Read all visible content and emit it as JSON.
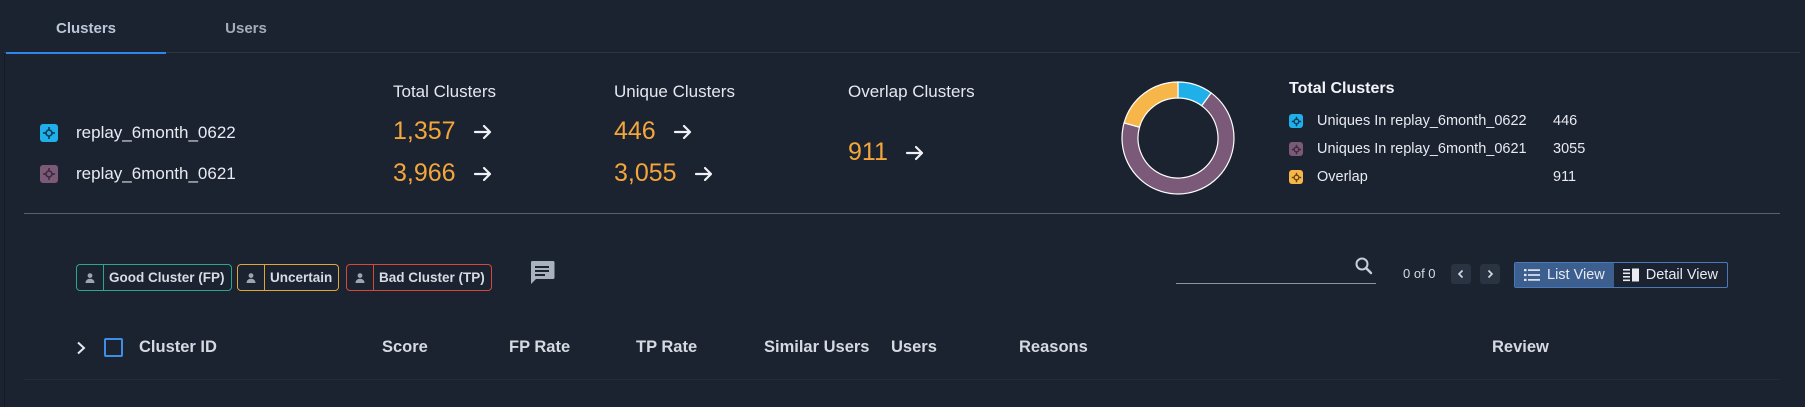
{
  "tabs": [
    {
      "label": "Clusters",
      "active": true
    },
    {
      "label": "Users",
      "active": false
    }
  ],
  "datasets": [
    {
      "name": "replay_6month_0622",
      "color": "#1fb0ea"
    },
    {
      "name": "replay_6month_0621",
      "color": "#7a5a78"
    }
  ],
  "metrics": {
    "total": {
      "title": "Total Clusters",
      "values": [
        "1,357",
        "3,966"
      ]
    },
    "unique": {
      "title": "Unique Clusters",
      "values": [
        "446",
        "3,055"
      ]
    },
    "overlap": {
      "title": "Overlap Clusters",
      "value": "911"
    }
  },
  "chart_data": {
    "type": "pie",
    "title": "Total Clusters",
    "categories": [
      "Uniques In replay_6month_0622",
      "Uniques In replay_6month_0621",
      "Overlap"
    ],
    "values": [
      446,
      3055,
      911
    ],
    "colors": [
      "#1fb0ea",
      "#7a5a78",
      "#f6b64a"
    ],
    "legend_placement": "right"
  },
  "legend": {
    "title": "Total Clusters",
    "rows": [
      {
        "label": "Uniques In replay_6month_0622",
        "value": "446",
        "color": "#1fb0ea"
      },
      {
        "label": "Uniques In replay_6month_0621",
        "value": "3055",
        "color": "#7a5a78"
      },
      {
        "label": "Overlap",
        "value": "911",
        "color": "#f6b64a"
      }
    ]
  },
  "feedback": {
    "good": {
      "label": "Good Cluster (FP)",
      "color": "#2fa58c"
    },
    "uncertain": {
      "label": "Uncertain",
      "color": "#e0a63a"
    },
    "bad": {
      "label": "Bad Cluster (TP)",
      "color": "#d6483a"
    }
  },
  "search": {
    "placeholder": "",
    "value": ""
  },
  "pager": {
    "text": "0 of 0"
  },
  "view_toggle": {
    "list": "List View",
    "detail": "Detail View",
    "active": "list"
  },
  "table": {
    "columns": [
      "Cluster ID",
      "Score",
      "FP Rate",
      "TP Rate",
      "Similar Users",
      "Users",
      "Reasons",
      "Review"
    ]
  },
  "colors": {
    "accent": "#2f86e8",
    "number": "#f4a63b",
    "background": "#1b2230"
  }
}
